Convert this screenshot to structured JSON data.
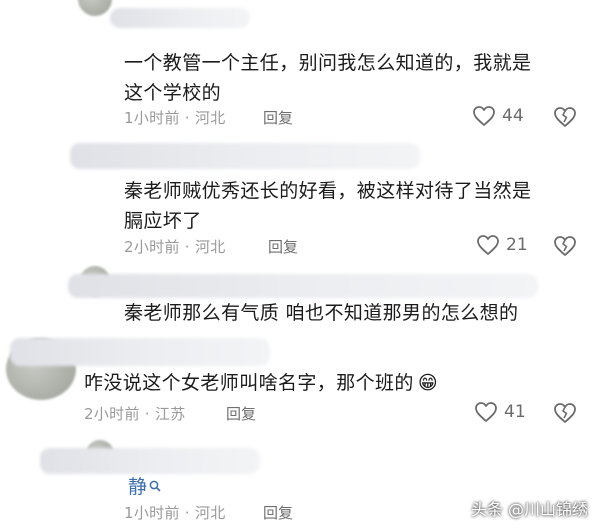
{
  "comments": [
    {
      "text_line1": "一个教管一个主任，别问我怎么知道的，我就是",
      "text_line2": "这个学校的",
      "time": "1小时前 · 河北",
      "reply_label": "回复",
      "likes": "44"
    },
    {
      "text_line1": "秦老师贼优秀还长的好看，被这样对待了当然是",
      "text_line2": "膈应坏了",
      "time": "2小时前 · 河北",
      "reply_label": "回复",
      "likes": "21"
    },
    {
      "text_line1": "秦老师那么有气质 咱也不知道那男的怎么想的"
    },
    {
      "text_line1": "咋没说这个女老师叫啥名字，那个班的",
      "emoji": "😁",
      "time": "2小时前 · 江苏",
      "reply_label": "回复",
      "likes": "41"
    },
    {
      "name_partial": "静",
      "time": "1小时前 · 河北",
      "reply_label": "回复"
    }
  ],
  "watermark": "头条 @川山锦绣",
  "icons": {
    "like": "heart-outline-icon",
    "dislike": "broken-heart-icon",
    "search": "search-icon"
  },
  "colors": {
    "text": "#1b1b1b",
    "meta": "#9a9a9a",
    "name_link": "#3b6fb0"
  }
}
